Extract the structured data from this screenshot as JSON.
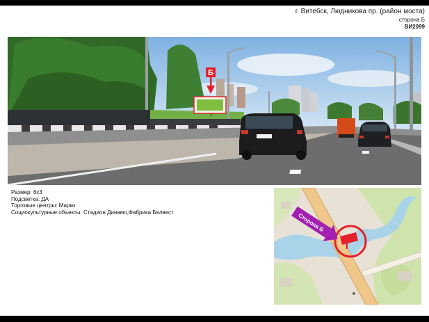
{
  "header": {
    "address": "г. Витебск, Людникова пр. (район моста)",
    "side": "сторона Б",
    "code": "ВИ2099"
  },
  "photo": {
    "marker_letter": "Б"
  },
  "info": {
    "size": "Размер: 6х3",
    "lighting": "Подсветка: ДА",
    "malls": "Торговые центры: Марко",
    "social": "Социокультурные объекты: Стадион Динамо,Фабрика Белвест"
  },
  "map": {
    "arrow_label": "Сторона Б"
  },
  "colors": {
    "accent_red": "#e5202a",
    "map_arrow": "#a21fb0",
    "water": "#a9d3e8",
    "park_green": "#cfe3ac"
  }
}
